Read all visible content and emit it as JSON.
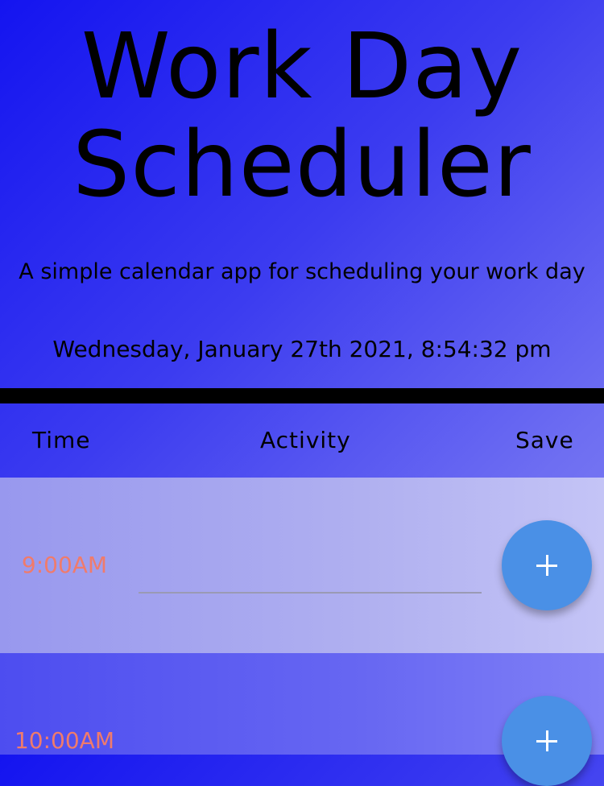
{
  "header": {
    "title_line1": "Work Day",
    "title_line2": "Scheduler",
    "subtitle": "A simple calendar app for scheduling your work day",
    "current_datetime": "Wednesday, January 27th 2021, 8:54:32 pm"
  },
  "columns": {
    "time": "Time",
    "activity": "Activity",
    "save": "Save"
  },
  "rows": [
    {
      "hour": "9:00AM",
      "activity_value": "",
      "status": "past"
    },
    {
      "hour": "10:00AM",
      "activity_value": "",
      "status": "future"
    }
  ],
  "icons": {
    "save": "plus-icon"
  },
  "colors": {
    "hour_text": "#f07b6b",
    "save_button": "#4a90e6",
    "divider": "#000000"
  }
}
